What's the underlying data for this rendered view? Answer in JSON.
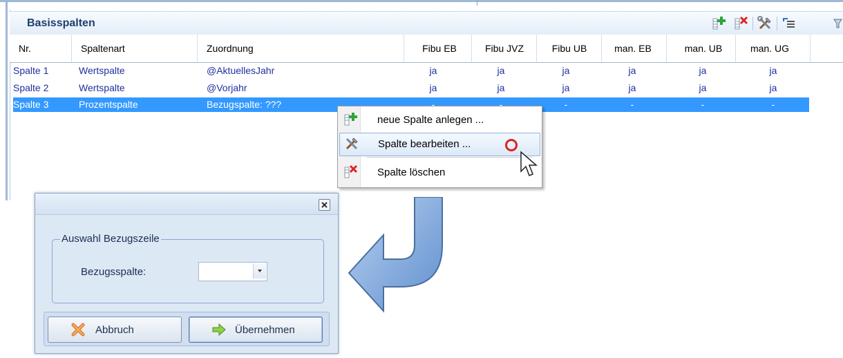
{
  "panel": {
    "title": "Basisspalten",
    "toolbar_icons": [
      "add-column-icon",
      "delete-column-icon",
      "tools-icon",
      "sort-icon",
      "filter-icon"
    ]
  },
  "table": {
    "headers": [
      "Nr.",
      "Spaltenart",
      "Zuordnung",
      "Fibu EB",
      "Fibu JVZ",
      "Fibu UB",
      "man. EB",
      "man. UB",
      "man. UG"
    ],
    "rows": [
      {
        "nr": "Spalte 1",
        "art": "Wertspalte",
        "zuordnung": "@AktuellesJahr",
        "vals": [
          "ja",
          "ja",
          "ja",
          "ja",
          "ja",
          "ja"
        ]
      },
      {
        "nr": "Spalte 2",
        "art": "Wertspalte",
        "zuordnung": "@Vorjahr",
        "vals": [
          "ja",
          "ja",
          "ja",
          "ja",
          "ja",
          "ja"
        ]
      },
      {
        "nr": "Spalte 3",
        "art": "Prozentspalte",
        "zuordnung": "Bezugspalte: ???",
        "vals": [
          "-",
          "-",
          "-",
          "-",
          "-",
          "-"
        ]
      }
    ],
    "selected_row_index": 2
  },
  "context_menu": {
    "items": [
      {
        "label": "neue Spalte anlegen ...",
        "icon": "add-column-icon"
      },
      {
        "label": "Spalte bearbeiten ...",
        "icon": "tools-icon"
      },
      {
        "label": "Spalte löschen",
        "icon": "delete-column-icon"
      }
    ],
    "hovered_index": 1
  },
  "dialog": {
    "group_title": "Auswahl Bezugszeile",
    "field_label": "Bezugsspalte:",
    "field_value": "",
    "cancel_label": "Abbruch",
    "ok_label": "Übernehmen"
  },
  "colors": {
    "selection": "#3399ff",
    "row_text": "#1f2f9f",
    "arrow_fill": "#7ea6d9"
  }
}
